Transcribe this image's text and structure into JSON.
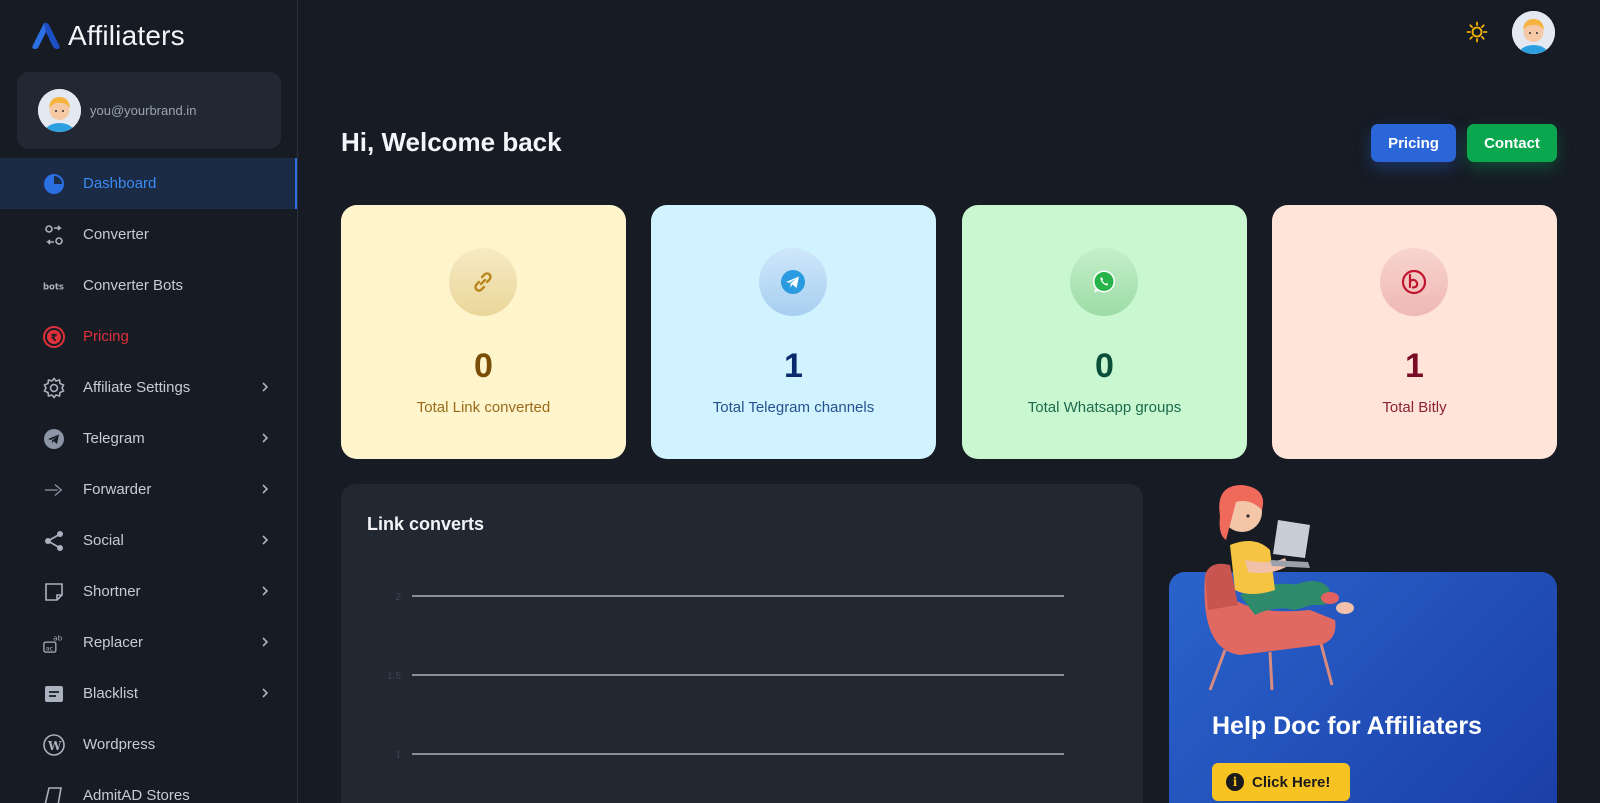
{
  "brand": {
    "name": "Affiliaters",
    "logo_icon": "affiliaters-logo-icon"
  },
  "user": {
    "email": "you@yourbrand.in"
  },
  "sidebar": {
    "items": [
      {
        "label": "Dashboard",
        "icon": "pie-chart-icon",
        "active": true
      },
      {
        "label": "Converter",
        "icon": "convert-icon"
      },
      {
        "label": "Converter Bots",
        "icon": "bots-icon"
      },
      {
        "label": "Pricing",
        "icon": "rupee-icon",
        "highlight": "#e0303a"
      },
      {
        "label": "Affiliate Settings",
        "icon": "gear-icon",
        "has_submenu": true
      },
      {
        "label": "Telegram",
        "icon": "telegram-icon",
        "has_submenu": true
      },
      {
        "label": "Forwarder",
        "icon": "forward-arrow-icon",
        "has_submenu": true
      },
      {
        "label": "Social",
        "icon": "share-icon",
        "has_submenu": true
      },
      {
        "label": "Shortner",
        "icon": "scissors-frame-icon",
        "has_submenu": true
      },
      {
        "label": "Replacer",
        "icon": "replace-icon",
        "has_submenu": true
      },
      {
        "label": "Blacklist",
        "icon": "blacklist-icon",
        "has_submenu": true
      },
      {
        "label": "Wordpress",
        "icon": "wordpress-icon"
      },
      {
        "label": "AdmitAD Stores",
        "icon": "store-icon"
      }
    ]
  },
  "header": {
    "theme_icon": "sun-icon"
  },
  "welcome": {
    "title": "Hi, Welcome back"
  },
  "actions": {
    "pricing_label": "Pricing",
    "contact_label": "Contact"
  },
  "stats": [
    {
      "value": "0",
      "label": "Total Link converted",
      "icon": "link-icon"
    },
    {
      "value": "1",
      "label": "Total Telegram channels",
      "icon": "telegram-icon"
    },
    {
      "value": "0",
      "label": "Total Whatsapp groups",
      "icon": "whatsapp-icon"
    },
    {
      "value": "1",
      "label": "Total Bitly",
      "icon": "bitly-icon"
    }
  ],
  "chart": {
    "title": "Link converts",
    "y_ticks": [
      "2",
      "1.5",
      "1"
    ]
  },
  "chart_data": {
    "type": "line",
    "title": "Link converts",
    "y_ticks": [
      2,
      1.5,
      1
    ],
    "grid": true,
    "series": []
  },
  "help": {
    "title": "Help Doc for Affiliaters",
    "button_label": "Click Here!",
    "button_icon": "info-icon"
  },
  "colors": {
    "accent": "#2b66d8",
    "contact": "#0aa74f",
    "pricing_nav": "#e0303a",
    "help_button": "#f7c322"
  }
}
